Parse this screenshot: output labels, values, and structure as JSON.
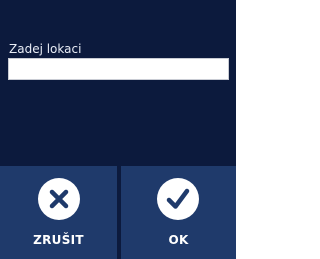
{
  "prompt": {
    "label": "Zadej lokaci"
  },
  "location_input": {
    "value": "",
    "placeholder": ""
  },
  "buttons": {
    "cancel": {
      "label": "ZRUŠIT",
      "icon": "close-icon"
    },
    "ok": {
      "label": "OK",
      "icon": "checkmark-icon"
    }
  },
  "colors": {
    "background": "#0c1a3d",
    "button_background": "#1f3a6b",
    "icon_circle": "#ffffff",
    "icon_glyph": "#1f3a6b",
    "text": "#ffffff"
  }
}
